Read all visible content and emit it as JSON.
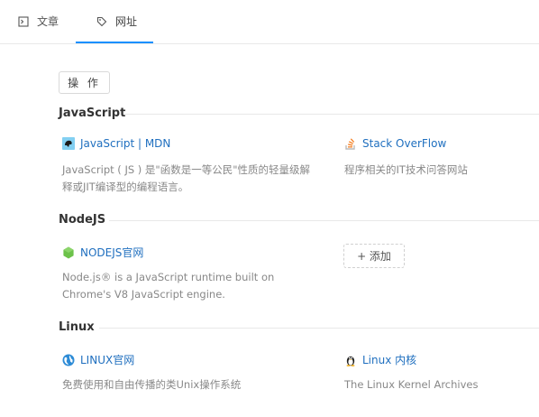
{
  "tabs": [
    {
      "label": "文章",
      "icon": "article-icon"
    },
    {
      "label": "网址",
      "icon": "tag-icon",
      "active": true
    }
  ],
  "colors": {
    "accent": "#1890ff",
    "link": "#1f6fbf"
  },
  "operate_label": "操 作",
  "sections": [
    {
      "title": "JavaScript",
      "items": [
        {
          "title": "JavaScript | MDN",
          "icon": "mdn-icon",
          "desc": "JavaScript ( JS ) 是\"函数是一等公民\"性质的轻量级解释或JIT编译型的编程语言。"
        },
        {
          "title": "Stack OverFlow",
          "icon": "stackoverflow-icon",
          "desc": "程序相关的IT技术问答网站"
        }
      ]
    },
    {
      "title": "NodeJS",
      "items": [
        {
          "title": "NODEJS官网",
          "icon": "nodejs-icon",
          "desc": "Node.js® is a JavaScript runtime built on Chrome's V8 JavaScript engine."
        }
      ],
      "add_label": "+ 添加"
    },
    {
      "title": "Linux",
      "items": [
        {
          "title": "LINUX官网",
          "icon": "globe-icon",
          "desc": "免费使用和自由传播的类Unix操作系统"
        },
        {
          "title": "Linux 内核",
          "icon": "tux-icon",
          "desc": "The Linux Kernel Archives"
        }
      ]
    }
  ]
}
